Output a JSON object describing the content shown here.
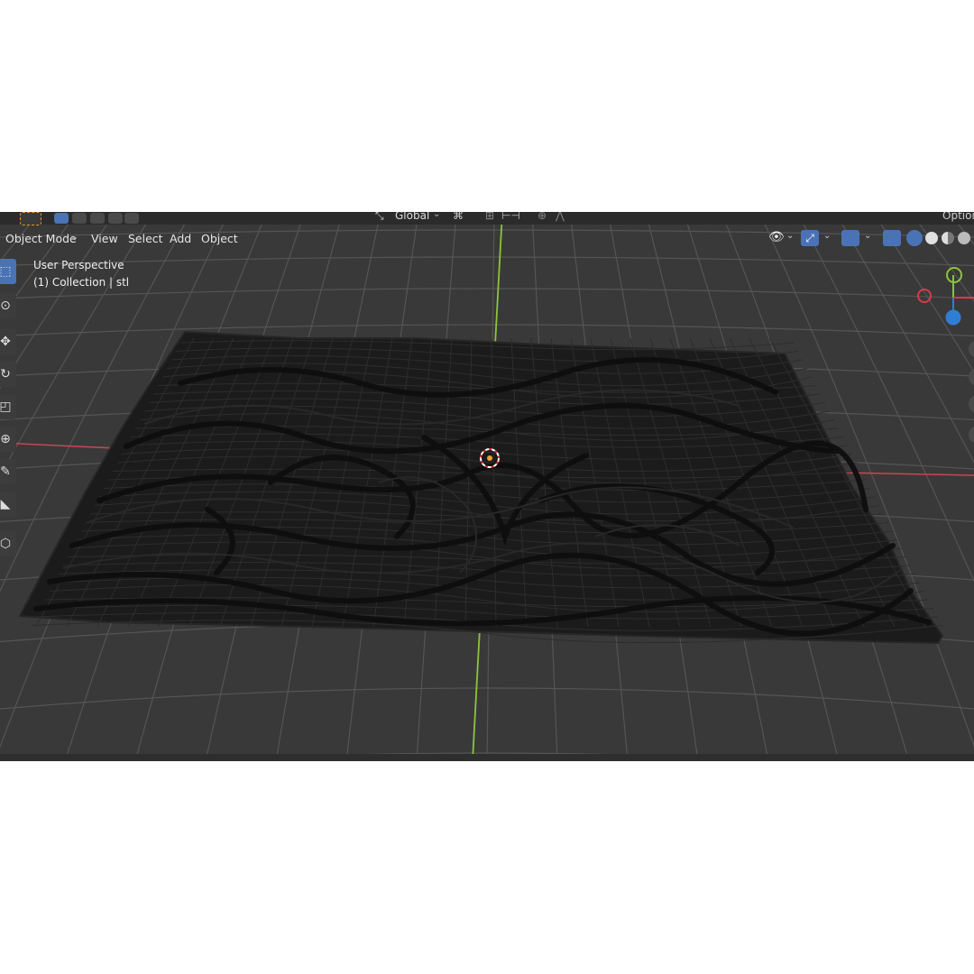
{
  "header": {
    "mode_label": "Object Mode",
    "menus": [
      "View",
      "Select",
      "Add",
      "Object"
    ],
    "transform_orientation": "Global",
    "options_label": "Options"
  },
  "viewport": {
    "view_name": "User Perspective",
    "collection_label": "(1) Collection | stl"
  },
  "gizmo": {
    "x_color": "#d83b4a",
    "y_color": "#7ab51e",
    "z_color": "#2f7ed6"
  },
  "icons": {
    "tools": [
      "select-box-icon",
      "cursor-icon",
      "move-icon",
      "rotate-icon",
      "scale-icon",
      "transform-icon",
      "annotate-icon",
      "measure-icon",
      "add-cube-icon"
    ]
  },
  "colors": {
    "background": "#393939",
    "grid": "#5a5a5a",
    "x_axis": "#c84652",
    "y_axis": "#8cc43a",
    "active_tool": "#4a73b5",
    "mesh": "#161616"
  }
}
